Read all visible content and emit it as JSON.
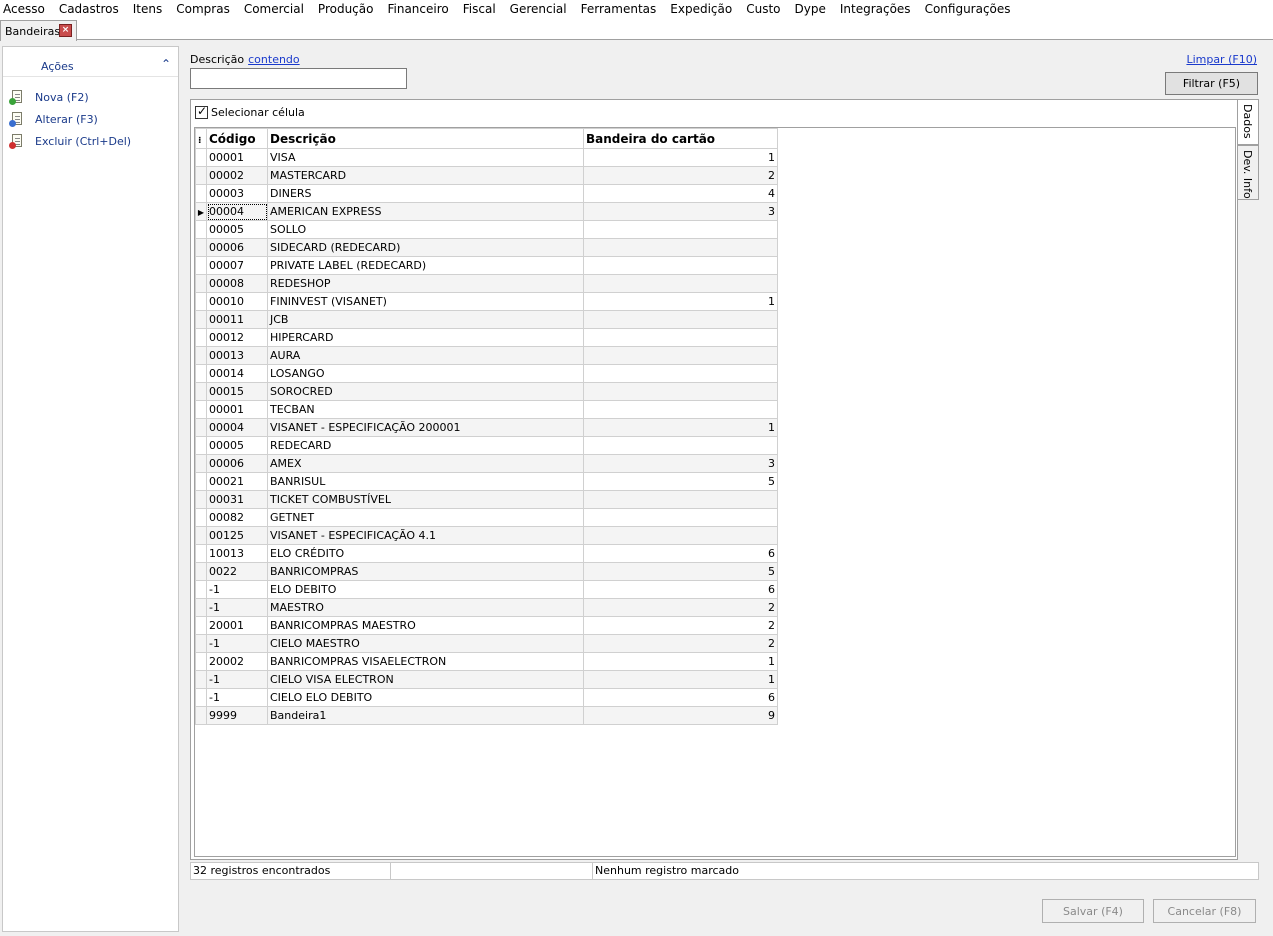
{
  "menu": [
    "Acesso",
    "Cadastros",
    "Itens",
    "Compras",
    "Comercial",
    "Produção",
    "Financeiro",
    "Fiscal",
    "Gerencial",
    "Ferramentas",
    "Expedição",
    "Custo",
    "Dype",
    "Integrações",
    "Configurações"
  ],
  "tab": {
    "label": "Bandeiras",
    "close": "×"
  },
  "actions": {
    "title": "Ações",
    "new_label": "Nova (F2)",
    "edit_label": "Alterar (F3)",
    "delete_label": "Excluir (Ctrl+Del)"
  },
  "filter": {
    "field_label": "Descrição",
    "operator": "contendo",
    "value": "",
    "clear_label": "Limpar (F10)",
    "filter_button": "Filtrar (F5)"
  },
  "grid": {
    "select_cell_label": "Selecionar célula",
    "select_cell_checked": true,
    "columns": [
      "Código",
      "Descrição",
      "Bandeira do cartão"
    ],
    "rows": [
      [
        "00001",
        "VISA",
        "1"
      ],
      [
        "00002",
        "MASTERCARD",
        "2"
      ],
      [
        "00003",
        "DINERS",
        "4"
      ],
      [
        "00004",
        "AMERICAN EXPRESS",
        "3"
      ],
      [
        "00005",
        "SOLLO",
        ""
      ],
      [
        "00006",
        "SIDECARD (REDECARD)",
        ""
      ],
      [
        "00007",
        "PRIVATE LABEL (REDECARD)",
        ""
      ],
      [
        "00008",
        "REDESHOP",
        ""
      ],
      [
        "00010",
        "FININVEST (VISANET)",
        "1"
      ],
      [
        "00011",
        "JCB",
        ""
      ],
      [
        "00012",
        "HIPERCARD",
        ""
      ],
      [
        "00013",
        "AURA",
        ""
      ],
      [
        "00014",
        "LOSANGO",
        ""
      ],
      [
        "00015",
        "SOROCRED",
        ""
      ],
      [
        "00001",
        "TECBAN",
        ""
      ],
      [
        "00004",
        "VISANET - ESPECIFICAÇÃO 200001",
        "1"
      ],
      [
        "00005",
        "REDECARD",
        ""
      ],
      [
        "00006",
        "AMEX",
        "3"
      ],
      [
        "00021",
        "BANRISUL",
        "5"
      ],
      [
        "00031",
        "TICKET COMBUSTÍVEL",
        ""
      ],
      [
        "00082",
        "GETNET",
        ""
      ],
      [
        "00125",
        "VISANET - ESPECIFICAÇÃO 4.1",
        ""
      ],
      [
        "10013",
        "ELO CRÉDITO",
        "6"
      ],
      [
        "0022",
        "BANRICOMPRAS",
        "5"
      ],
      [
        "-1",
        "ELO DEBITO",
        "6"
      ],
      [
        "-1",
        "MAESTRO",
        "2"
      ],
      [
        "20001",
        "BANRICOMPRAS MAESTRO",
        "2"
      ],
      [
        "-1",
        "CIELO MAESTRO",
        "2"
      ],
      [
        "20002",
        "BANRICOMPRAS VISAELECTRON",
        "1"
      ],
      [
        "-1",
        "CIELO VISA ELECTRON",
        "1"
      ],
      [
        "-1",
        "CIELO ELO DEBITO",
        "6"
      ],
      [
        "9999",
        "Bandeira1",
        "9"
      ]
    ],
    "current_row": 3
  },
  "side_tabs": [
    "Dados",
    "Dev. Info"
  ],
  "status": {
    "count": "32 registros encontrados",
    "middle": "",
    "marked": "Nenhum registro marcado"
  },
  "buttons": {
    "save": "Salvar (F4)",
    "cancel": "Cancelar (F8)"
  },
  "icons": {
    "new": "new-document-icon",
    "edit": "edit-document-icon",
    "delete": "delete-document-icon",
    "collapse": "chevron-up-icon",
    "row_indicator": "row-pointer-icon",
    "column_chooser": "column-chooser-icon",
    "checkbox": "checkmark-icon"
  }
}
